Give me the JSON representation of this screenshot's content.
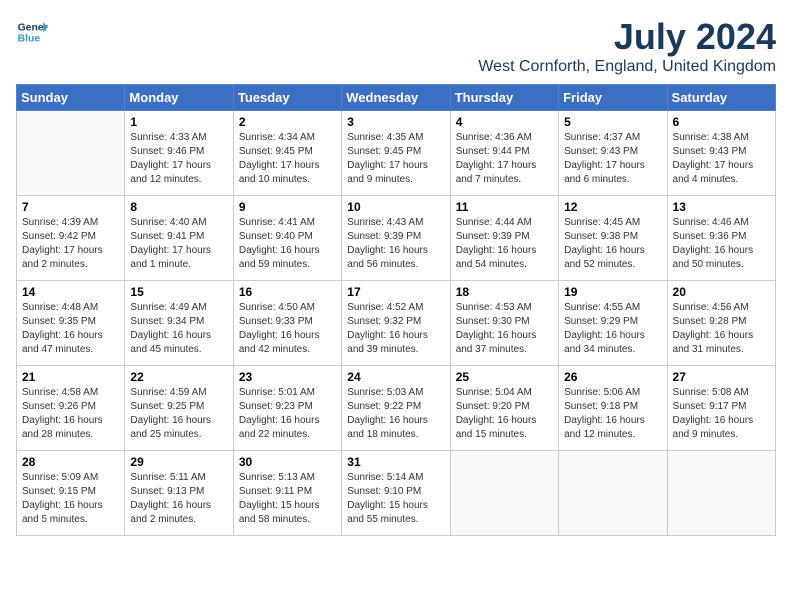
{
  "header": {
    "logo_line1": "General",
    "logo_line2": "Blue",
    "month_year": "July 2024",
    "location": "West Cornforth, England, United Kingdom"
  },
  "days_of_week": [
    "Sunday",
    "Monday",
    "Tuesday",
    "Wednesday",
    "Thursday",
    "Friday",
    "Saturday"
  ],
  "weeks": [
    [
      {
        "day": "",
        "info": ""
      },
      {
        "day": "1",
        "info": "Sunrise: 4:33 AM\nSunset: 9:46 PM\nDaylight: 17 hours\nand 12 minutes."
      },
      {
        "day": "2",
        "info": "Sunrise: 4:34 AM\nSunset: 9:45 PM\nDaylight: 17 hours\nand 10 minutes."
      },
      {
        "day": "3",
        "info": "Sunrise: 4:35 AM\nSunset: 9:45 PM\nDaylight: 17 hours\nand 9 minutes."
      },
      {
        "day": "4",
        "info": "Sunrise: 4:36 AM\nSunset: 9:44 PM\nDaylight: 17 hours\nand 7 minutes."
      },
      {
        "day": "5",
        "info": "Sunrise: 4:37 AM\nSunset: 9:43 PM\nDaylight: 17 hours\nand 6 minutes."
      },
      {
        "day": "6",
        "info": "Sunrise: 4:38 AM\nSunset: 9:43 PM\nDaylight: 17 hours\nand 4 minutes."
      }
    ],
    [
      {
        "day": "7",
        "info": "Sunrise: 4:39 AM\nSunset: 9:42 PM\nDaylight: 17 hours\nand 2 minutes."
      },
      {
        "day": "8",
        "info": "Sunrise: 4:40 AM\nSunset: 9:41 PM\nDaylight: 17 hours\nand 1 minute."
      },
      {
        "day": "9",
        "info": "Sunrise: 4:41 AM\nSunset: 9:40 PM\nDaylight: 16 hours\nand 59 minutes."
      },
      {
        "day": "10",
        "info": "Sunrise: 4:43 AM\nSunset: 9:39 PM\nDaylight: 16 hours\nand 56 minutes."
      },
      {
        "day": "11",
        "info": "Sunrise: 4:44 AM\nSunset: 9:39 PM\nDaylight: 16 hours\nand 54 minutes."
      },
      {
        "day": "12",
        "info": "Sunrise: 4:45 AM\nSunset: 9:38 PM\nDaylight: 16 hours\nand 52 minutes."
      },
      {
        "day": "13",
        "info": "Sunrise: 4:46 AM\nSunset: 9:36 PM\nDaylight: 16 hours\nand 50 minutes."
      }
    ],
    [
      {
        "day": "14",
        "info": "Sunrise: 4:48 AM\nSunset: 9:35 PM\nDaylight: 16 hours\nand 47 minutes."
      },
      {
        "day": "15",
        "info": "Sunrise: 4:49 AM\nSunset: 9:34 PM\nDaylight: 16 hours\nand 45 minutes."
      },
      {
        "day": "16",
        "info": "Sunrise: 4:50 AM\nSunset: 9:33 PM\nDaylight: 16 hours\nand 42 minutes."
      },
      {
        "day": "17",
        "info": "Sunrise: 4:52 AM\nSunset: 9:32 PM\nDaylight: 16 hours\nand 39 minutes."
      },
      {
        "day": "18",
        "info": "Sunrise: 4:53 AM\nSunset: 9:30 PM\nDaylight: 16 hours\nand 37 minutes."
      },
      {
        "day": "19",
        "info": "Sunrise: 4:55 AM\nSunset: 9:29 PM\nDaylight: 16 hours\nand 34 minutes."
      },
      {
        "day": "20",
        "info": "Sunrise: 4:56 AM\nSunset: 9:28 PM\nDaylight: 16 hours\nand 31 minutes."
      }
    ],
    [
      {
        "day": "21",
        "info": "Sunrise: 4:58 AM\nSunset: 9:26 PM\nDaylight: 16 hours\nand 28 minutes."
      },
      {
        "day": "22",
        "info": "Sunrise: 4:59 AM\nSunset: 9:25 PM\nDaylight: 16 hours\nand 25 minutes."
      },
      {
        "day": "23",
        "info": "Sunrise: 5:01 AM\nSunset: 9:23 PM\nDaylight: 16 hours\nand 22 minutes."
      },
      {
        "day": "24",
        "info": "Sunrise: 5:03 AM\nSunset: 9:22 PM\nDaylight: 16 hours\nand 18 minutes."
      },
      {
        "day": "25",
        "info": "Sunrise: 5:04 AM\nSunset: 9:20 PM\nDaylight: 16 hours\nand 15 minutes."
      },
      {
        "day": "26",
        "info": "Sunrise: 5:06 AM\nSunset: 9:18 PM\nDaylight: 16 hours\nand 12 minutes."
      },
      {
        "day": "27",
        "info": "Sunrise: 5:08 AM\nSunset: 9:17 PM\nDaylight: 16 hours\nand 9 minutes."
      }
    ],
    [
      {
        "day": "28",
        "info": "Sunrise: 5:09 AM\nSunset: 9:15 PM\nDaylight: 16 hours\nand 5 minutes."
      },
      {
        "day": "29",
        "info": "Sunrise: 5:11 AM\nSunset: 9:13 PM\nDaylight: 16 hours\nand 2 minutes."
      },
      {
        "day": "30",
        "info": "Sunrise: 5:13 AM\nSunset: 9:11 PM\nDaylight: 15 hours\nand 58 minutes."
      },
      {
        "day": "31",
        "info": "Sunrise: 5:14 AM\nSunset: 9:10 PM\nDaylight: 15 hours\nand 55 minutes."
      },
      {
        "day": "",
        "info": ""
      },
      {
        "day": "",
        "info": ""
      },
      {
        "day": "",
        "info": ""
      }
    ]
  ]
}
